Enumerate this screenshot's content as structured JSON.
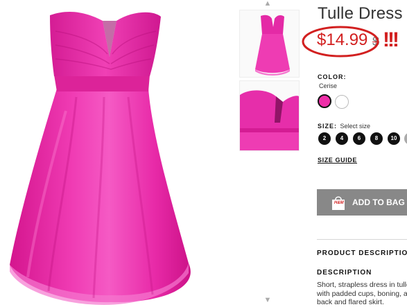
{
  "product": {
    "title": "Tulle Dress",
    "price": "$14.99",
    "old_price": "$",
    "annotation_marks": "!!!"
  },
  "gallery": {
    "up_arrow": "▲",
    "down_arrow": "▼"
  },
  "color": {
    "label": "COLOR:",
    "selected_name": "Cerise",
    "swatches": [
      "#ee2ea8",
      "#ffffff"
    ]
  },
  "size": {
    "label": "SIZE:",
    "prompt": "Select size",
    "options": [
      "2",
      "4",
      "6",
      "8",
      "10"
    ],
    "guide_label": "SIZE GUIDE"
  },
  "cart": {
    "add_label": "ADD TO BAG",
    "brand_mark": "H&M"
  },
  "details": {
    "section_title": "PRODUCT DESCRIPTION",
    "description_heading": "DESCRIPTION",
    "description_text": "Short, strapless dress in tulle with padded cups, boning, and back and flared skirt."
  },
  "colors": {
    "accent_red": "#d22020",
    "dress_pink": "#ee2ea8",
    "button_gray": "#888888"
  }
}
